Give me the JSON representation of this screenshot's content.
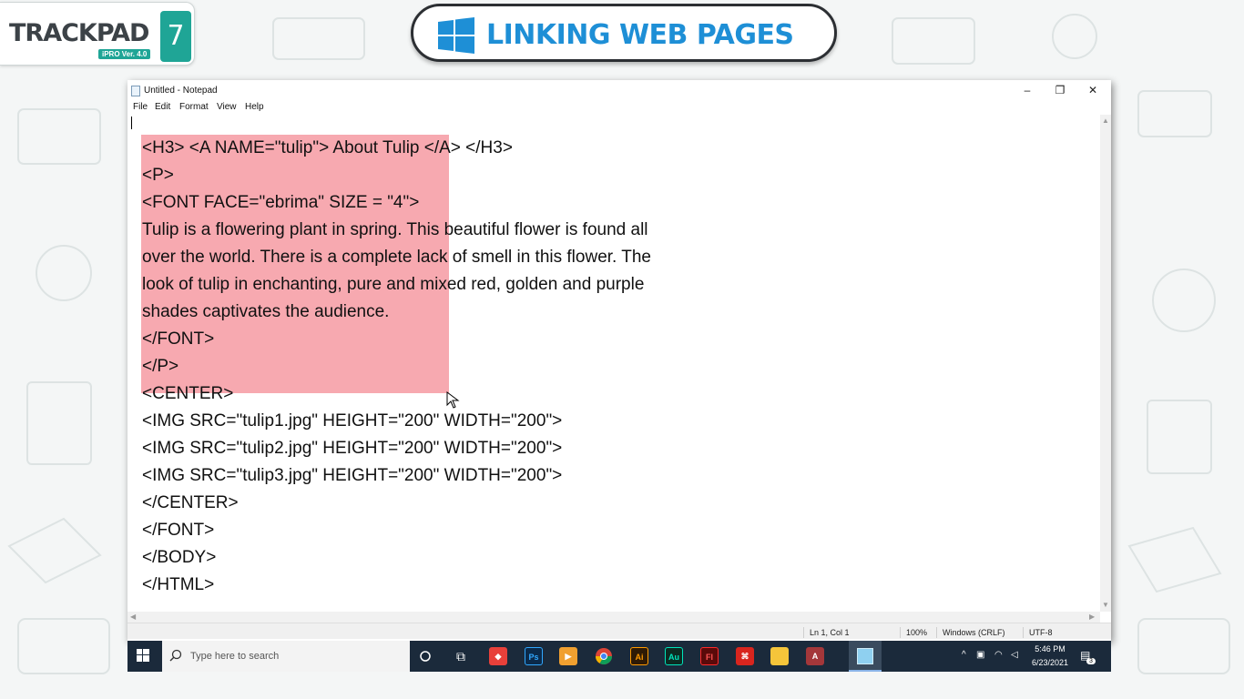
{
  "brand": {
    "logo_text": "TRACKPAD",
    "logo_number": "7",
    "version": "iPRO Ver. 4.0"
  },
  "banner": {
    "title": "LINKING WEB PAGES"
  },
  "window": {
    "title": "Untitled - Notepad",
    "controls": {
      "minimize": "–",
      "restore": "❐",
      "close": "✕"
    }
  },
  "menu": [
    "File",
    "Edit",
    "Format",
    "View",
    "Help"
  ],
  "editor": {
    "lines": [
      "<H3> <A NAME=\"tulip\"> About Tulip </A> </H3>",
      "<P>",
      "<FONT FACE=\"ebrima\" SIZE = \"4\">",
      "Tulip is a flowering plant in spring. This beautiful flower is found all",
      "over the world. There is a complete lack of smell in this flower. The",
      "look of tulip in enchanting, pure and mixed red, golden and purple",
      "shades captivates the audience.",
      "</FONT>",
      "</P>",
      "<CENTER>",
      "<IMG SRC=\"tulip1.jpg\" HEIGHT=\"200\" WIDTH=\"200\">",
      "<IMG SRC=\"tulip2.jpg\" HEIGHT=\"200\" WIDTH=\"200\">",
      "<IMG SRC=\"tulip3.jpg\" HEIGHT=\"200\" WIDTH=\"200\">",
      "</CENTER>",
      "</FONT>",
      "</BODY>",
      "</HTML>"
    ],
    "selection_color": "#f7a9b0"
  },
  "status": {
    "position": "Ln 1, Col 1",
    "zoom": "100%",
    "line_ending": "Windows (CRLF)",
    "encoding": "UTF-8"
  },
  "taskbar": {
    "search_placeholder": "Type here to search",
    "apps": [
      {
        "name": "task-view",
        "label": ""
      },
      {
        "name": "anydesk",
        "label": ""
      },
      {
        "name": "photoshop",
        "label": "Ps"
      },
      {
        "name": "media-player",
        "label": ""
      },
      {
        "name": "chrome",
        "label": ""
      },
      {
        "name": "illustrator",
        "label": "Ai"
      },
      {
        "name": "audition",
        "label": "Au"
      },
      {
        "name": "flash",
        "label": "Fl"
      },
      {
        "name": "acrobat",
        "label": ""
      },
      {
        "name": "file-explorer",
        "label": ""
      },
      {
        "name": "access",
        "label": "A"
      },
      {
        "name": "notepad",
        "label": ""
      }
    ],
    "time": "5:46 PM",
    "date": "6/23/2021",
    "notification_count": "3"
  },
  "colors": {
    "brand_teal": "#1fa596",
    "banner_blue": "#1e8fd6",
    "taskbar": "#1b2a3b"
  }
}
